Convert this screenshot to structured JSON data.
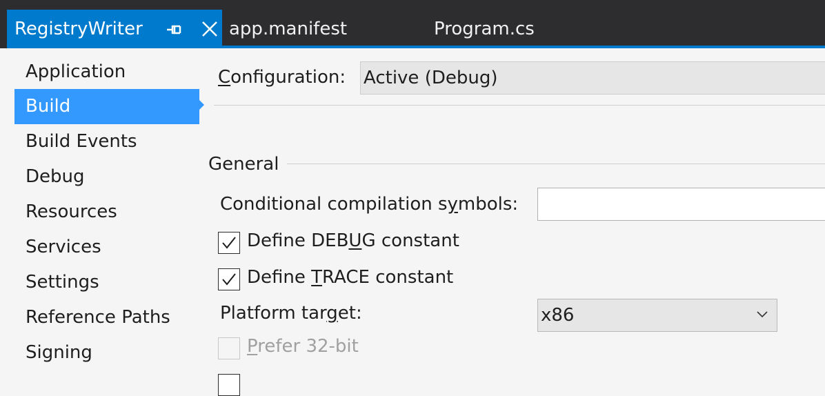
{
  "tabs": [
    {
      "label": "RegistryWriter",
      "active": true
    },
    {
      "label": "app.manifest",
      "active": false
    },
    {
      "label": "Program.cs",
      "active": false
    }
  ],
  "nav": {
    "items": [
      {
        "label": "Application"
      },
      {
        "label": "Build",
        "selected": true
      },
      {
        "label": "Build Events"
      },
      {
        "label": "Debug"
      },
      {
        "label": "Resources"
      },
      {
        "label": "Services"
      },
      {
        "label": "Settings"
      },
      {
        "label": "Reference Paths"
      },
      {
        "label": "Signing"
      }
    ]
  },
  "config": {
    "label_first": "C",
    "label_rest": "onfiguration:",
    "value": "Active (Debug)"
  },
  "general": {
    "title": "General",
    "cond_label_a": "Conditional compilation s",
    "cond_label_u": "y",
    "cond_label_b": "mbols:",
    "cond_value": "",
    "debug_a": "Define DEB",
    "debug_u": "U",
    "debug_b": "G constant",
    "debug_checked": true,
    "trace_a": "Define ",
    "trace_u": "T",
    "trace_b": "RACE constant",
    "trace_checked": true,
    "platform_a": "Platform tar",
    "platform_u": "g",
    "platform_b": "et:",
    "platform_value": "x86",
    "prefer_u": "P",
    "prefer_b": "refer 32-bit",
    "prefer_checked": false,
    "prefer_enabled": false
  },
  "colors": {
    "accent": "#007acc",
    "selection": "#3399ff",
    "tabstrip": "#2d2d30",
    "background": "#f5f5f5"
  },
  "icons": [
    "pin-icon",
    "close-icon",
    "checkmark-icon",
    "chevron-down-icon"
  ]
}
